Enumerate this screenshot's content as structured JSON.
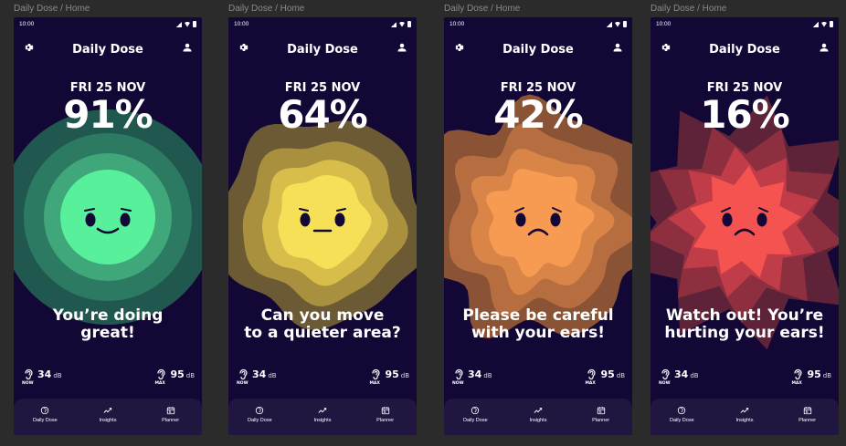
{
  "status_time": "10:00",
  "app_title": "Daily Dose",
  "date": "FRI 25 NOV",
  "stats": {
    "now_value": "34",
    "now_label": "NOW",
    "max_value": "95",
    "max_label": "MAX",
    "unit": "dB"
  },
  "nav": {
    "daily": "Daily Dose",
    "insights": "Insights",
    "planner": "Planner"
  },
  "screens": [
    {
      "label": "Daily Dose / Home",
      "percent": "91%",
      "line1": "You’re doing",
      "line2": "great!",
      "mood": "happy",
      "colors": [
        "#20584f",
        "#2d7a62",
        "#3fa77a",
        "#58f09b"
      ]
    },
    {
      "label": "Daily Dose / Home",
      "percent": "64%",
      "line1": "Can you move",
      "line2": "to a quieter area?",
      "mood": "neutral",
      "colors": [
        "#6b5a33",
        "#a8903f",
        "#d8bd4b",
        "#f6e058"
      ]
    },
    {
      "label": "Daily Dose / Home",
      "percent": "42%",
      "line1": "Please be careful",
      "line2": "with your ears!",
      "mood": "sad",
      "colors": [
        "#8a5335",
        "#b66e40",
        "#d98547",
        "#f79a52"
      ]
    },
    {
      "label": "Daily Dose / Home",
      "percent": "16%",
      "line1": "Watch out! You’re",
      "line2": "hurting your ears!",
      "mood": "sad",
      "colors": [
        "#5e2338",
        "#8e2f40",
        "#c03c48",
        "#f4534f"
      ]
    }
  ]
}
